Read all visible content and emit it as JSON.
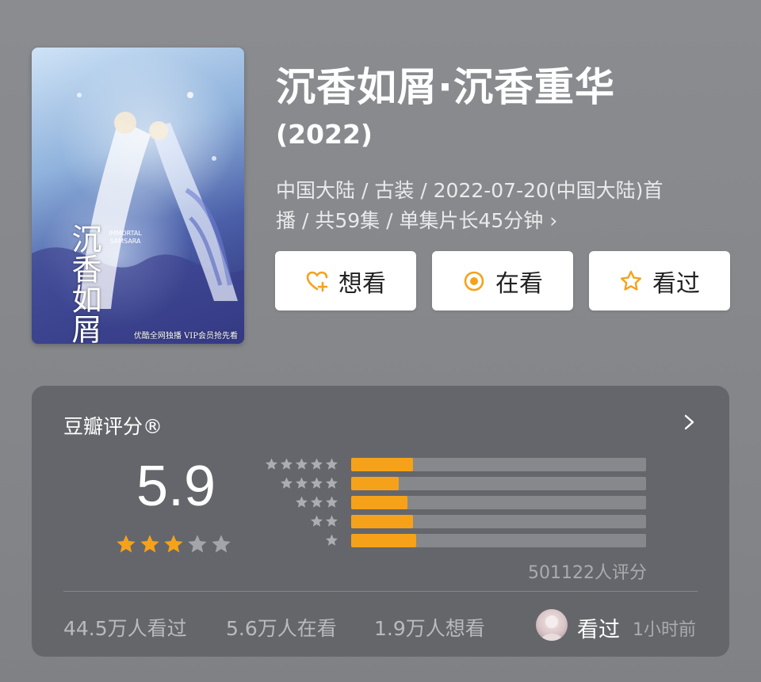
{
  "poster": {
    "title_calligraphy": "沉香如屑",
    "english_title": "IMMORTAL SAMSARA",
    "caption": "优酷全网独播 VIP会员抢先看"
  },
  "title": "沉香如屑·沉香重华",
  "year": "(2022)",
  "meta_line1": "中国大陆 / 古装 / 2022-07-20(中国大陆)首",
  "meta_line2": "播 / 共59集 / 单集片长45分钟",
  "meta_chevron": "›",
  "buttons": [
    {
      "label": "想看",
      "icon": "heart-plus-icon"
    },
    {
      "label": "在看",
      "icon": "target-circle-icon"
    },
    {
      "label": "看过",
      "icon": "star-outline-icon"
    }
  ],
  "rating": {
    "title": "豆瓣评分®",
    "score": "5.9",
    "stars_filled": 3,
    "stars_total": 5,
    "distribution": [
      {
        "stars": 5,
        "fraction": 0.21
      },
      {
        "stars": 4,
        "fraction": 0.16
      },
      {
        "stars": 3,
        "fraction": 0.19
      },
      {
        "stars": 2,
        "fraction": 0.21
      },
      {
        "stars": 1,
        "fraction": 0.22
      }
    ],
    "raters": "501122人评分"
  },
  "stats": {
    "watched": "44.5万人看过",
    "watching": "5.6万人在看",
    "want": "1.9万人想看"
  },
  "user_status": {
    "label": "看过",
    "time": "1小时前"
  },
  "colors": {
    "accent": "#f5a21a",
    "card_bg": "#626468",
    "page_bg": "#86888c"
  }
}
